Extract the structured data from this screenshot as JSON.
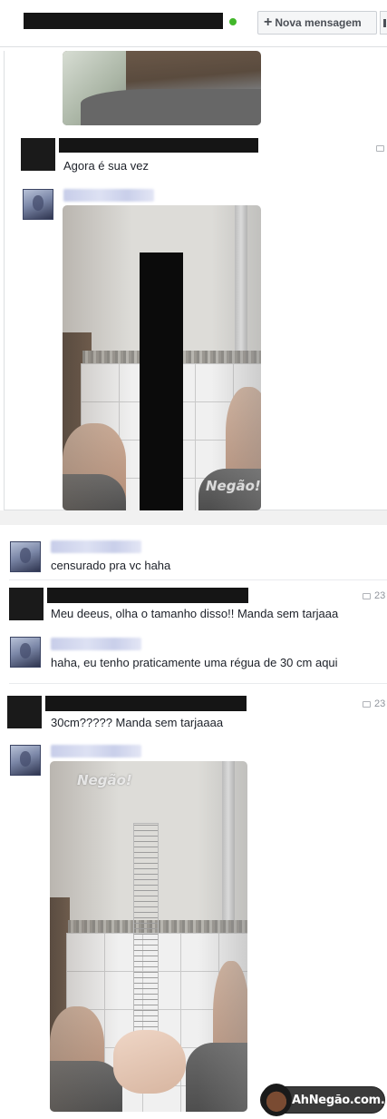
{
  "header": {
    "new_message_label": "Nova mensagem"
  },
  "thread1": {
    "messages": [
      {
        "text": "Agora é sua vez"
      }
    ],
    "photo_watermark": "Negão!"
  },
  "thread2": {
    "messages": [
      {
        "text": "censurado pra vc haha"
      },
      {
        "text": "Meu deeus, olha o tamanho disso!! Manda sem tarjaaa",
        "time": "23"
      },
      {
        "text": "haha, eu tenho praticamente uma régua de 30 cm aqui"
      },
      {
        "text": "30cm????? Manda sem tarjaaaa",
        "time": "23"
      }
    ],
    "photo_watermark": "Negão!"
  },
  "badge": {
    "label": "AhNegão.com.br"
  }
}
